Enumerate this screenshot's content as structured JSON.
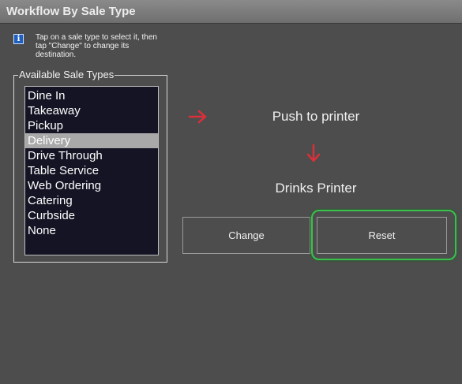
{
  "window": {
    "title": "Workflow By Sale Type"
  },
  "info": {
    "icon": "info-icon",
    "text": "Tap on a sale type to select it, then tap \"Change\" to change its destination."
  },
  "sale_types": {
    "label": "Available Sale Types",
    "selected": "Delivery",
    "items": [
      {
        "label": "Dine In"
      },
      {
        "label": "Takeaway"
      },
      {
        "label": "Pickup"
      },
      {
        "label": "Delivery"
      },
      {
        "label": "Drive Through"
      },
      {
        "label": "Table Service"
      },
      {
        "label": "Web Ordering"
      },
      {
        "label": "Catering"
      },
      {
        "label": "Curbside"
      },
      {
        "label": "None"
      }
    ]
  },
  "workflow": {
    "action": "Push to printer",
    "destination": "Drinks Printer",
    "arrow_color": "#d9303a",
    "arrow_right_icon": "arrow-right-icon",
    "arrow_down_icon": "arrow-down-icon"
  },
  "buttons": {
    "change_label": "Change",
    "reset_label": "Reset",
    "focus_color": "#37c24a"
  }
}
